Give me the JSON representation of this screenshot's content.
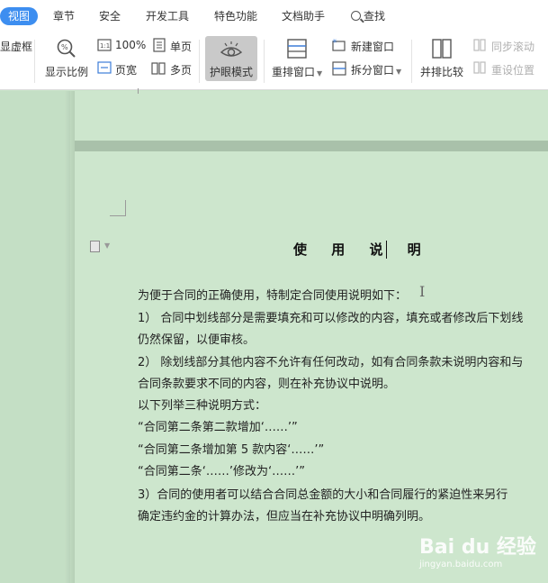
{
  "tabs": [
    {
      "label": "视图",
      "active": true
    },
    {
      "label": "章节"
    },
    {
      "label": "安全"
    },
    {
      "label": "开发工具"
    },
    {
      "label": "特色功能"
    },
    {
      "label": "文档助手"
    },
    {
      "label": "查找"
    }
  ],
  "ribbon": {
    "cut_label": "显虚框",
    "zoom_label": "显示比例",
    "percent100_label": "100%",
    "page_width_label": "页宽",
    "single_page_label": "单页",
    "multi_page_label": "多页",
    "eye_mode_label": "护眼模式",
    "rearrange_label": "重排窗口",
    "new_window_label": "新建窗口",
    "split_window_label": "拆分窗口",
    "side_by_side_label": "并排比较",
    "sync_scroll_label": "同步滚动",
    "reset_position_label": "重设位置"
  },
  "document": {
    "title": "使 用 说 明",
    "paragraphs": [
      "为便于合同的正确使用，特制定合同使用说明如下：",
      "1） 合同中划线部分是需要填充和可以修改的内容，填充或者修改后下划线",
      "仍然保留，以便审核。",
      "2） 除划线部分其他内容不允许有任何改动，如有合同条款未说明内容和与",
      "合同条款要求不同的内容，则在补充协议中说明。",
      "以下列举三种说明方式：",
      "“合同第二条第二款增加‘……’”",
      "“合同第二条增加第 5 款内容‘……’”",
      "“合同第二条‘……’修改为‘……’”",
      " 3）合同的使用者可以结合合同总金额的大小和合同履行的紧迫性来另行",
      "确定违约金的计算办法，但应当在补充协议中明确列明。"
    ]
  },
  "watermark": {
    "main": "Bai du 经验",
    "sub": "jingyan.baidu.com"
  }
}
